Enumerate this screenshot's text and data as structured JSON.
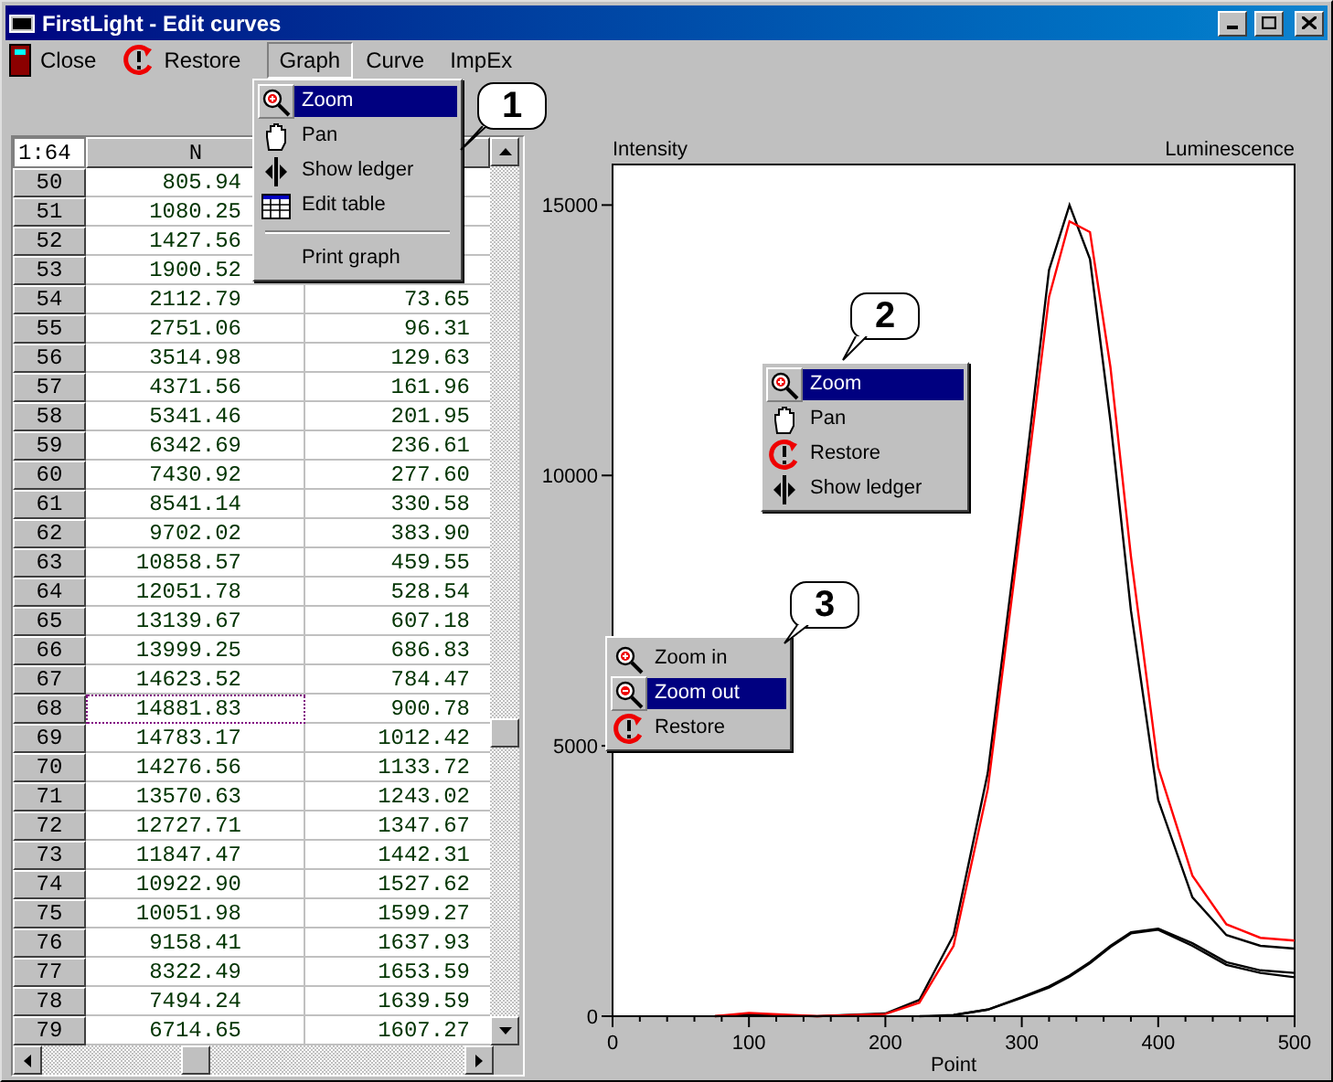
{
  "window": {
    "title": "FirstLight - Edit curves"
  },
  "toolbar": [
    {
      "label": "Close",
      "kind": "close"
    },
    {
      "label": "Restore",
      "kind": "restore"
    },
    {
      "label": "Graph",
      "kind": "menu",
      "selected": true
    },
    {
      "label": "Curve",
      "kind": "menu",
      "selected": false
    },
    {
      "label": "ImpEx",
      "kind": "menu",
      "selected": false
    }
  ],
  "table": {
    "corner": "1:64",
    "columns": [
      "N"
    ],
    "rows": [
      {
        "index": "50",
        "n": "805.94",
        "selected": false
      },
      {
        "index": "51",
        "n": "1080.25",
        "selected": false
      },
      {
        "index": "52",
        "n": "1427.56",
        "selected": false
      },
      {
        "index": "53",
        "n": "1900.52",
        "selected": false
      },
      {
        "index": "54",
        "n": "2112.79",
        "value": "73.65",
        "selected": false
      },
      {
        "index": "55",
        "n": "2751.06",
        "value": "96.31",
        "selected": false
      },
      {
        "index": "56",
        "n": "3514.98",
        "value": "129.63",
        "selected": false
      },
      {
        "index": "57",
        "n": "4371.56",
        "value": "161.96",
        "selected": false
      },
      {
        "index": "58",
        "n": "5341.46",
        "value": "201.95",
        "selected": false
      },
      {
        "index": "59",
        "n": "6342.69",
        "value": "236.61",
        "selected": false
      },
      {
        "index": "60",
        "n": "7430.92",
        "value": "277.60",
        "selected": false
      },
      {
        "index": "61",
        "n": "8541.14",
        "value": "330.58",
        "selected": false
      },
      {
        "index": "62",
        "n": "9702.02",
        "value": "383.90",
        "selected": false
      },
      {
        "index": "63",
        "n": "10858.57",
        "value": "459.55",
        "selected": false
      },
      {
        "index": "64",
        "n": "12051.78",
        "value": "528.54",
        "selected": false
      },
      {
        "index": "65",
        "n": "13139.67",
        "value": "607.18",
        "selected": false
      },
      {
        "index": "66",
        "n": "13999.25",
        "value": "686.83",
        "selected": false
      },
      {
        "index": "67",
        "n": "14623.52",
        "value": "784.47",
        "selected": false
      },
      {
        "index": "68",
        "n": "14881.83",
        "value": "900.78",
        "selected": true
      },
      {
        "index": "69",
        "n": "14783.17",
        "value": "1012.42",
        "selected": false
      },
      {
        "index": "70",
        "n": "14276.56",
        "value": "1133.72",
        "selected": false
      },
      {
        "index": "71",
        "n": "13570.63",
        "value": "1243.02",
        "selected": false
      },
      {
        "index": "72",
        "n": "12727.71",
        "value": "1347.67",
        "selected": false
      },
      {
        "index": "73",
        "n": "11847.47",
        "value": "1442.31",
        "selected": false
      },
      {
        "index": "74",
        "n": "10922.90",
        "value": "1527.62",
        "selected": false
      },
      {
        "index": "75",
        "n": "10051.98",
        "value": "1599.27",
        "selected": false
      },
      {
        "index": "76",
        "n": "9158.41",
        "value": "1637.93",
        "selected": false
      },
      {
        "index": "77",
        "n": "8322.49",
        "value": "1653.59",
        "selected": false
      },
      {
        "index": "78",
        "n": "7494.24",
        "value": "1639.59",
        "selected": false
      },
      {
        "index": "79",
        "n": "6714.65",
        "value": "1607.27",
        "selected": false
      }
    ]
  },
  "chart": {
    "left_label": "Intensity",
    "right_label": "Luminescence",
    "chart_data": {
      "type": "line",
      "xlabel": "Point",
      "x": [
        75,
        100,
        150,
        200,
        225,
        250,
        275,
        300,
        320,
        335,
        350,
        365,
        380,
        400,
        425,
        450,
        475,
        500
      ],
      "series": [
        {
          "color": "#000000",
          "values": [
            0,
            30,
            0,
            50,
            300,
            1500,
            4500,
            9500,
            13800,
            15000,
            14000,
            11000,
            7500,
            4000,
            2200,
            1500,
            1300,
            1250
          ]
        },
        {
          "color": "#ff0000",
          "values": [
            0,
            60,
            0,
            40,
            250,
            1300,
            4200,
            9200,
            13300,
            14700,
            14500,
            12000,
            8500,
            4600,
            2600,
            1700,
            1450,
            1400
          ]
        },
        {
          "color": "#000000",
          "values": [
            null,
            null,
            null,
            null,
            0,
            20,
            120,
            350,
            550,
            750,
            1000,
            1300,
            1550,
            1620,
            1350,
            1000,
            850,
            800
          ]
        },
        {
          "color": "#000000",
          "values": [
            null,
            null,
            null,
            null,
            null,
            20,
            120,
            340,
            530,
            730,
            980,
            1280,
            1530,
            1600,
            1300,
            950,
            800,
            720
          ]
        }
      ],
      "xlim": [
        0,
        500
      ],
      "ylim": [
        0,
        15750
      ],
      "xticks": [
        0,
        100,
        200,
        300,
        400,
        500
      ],
      "yticks": [
        0,
        5000,
        10000,
        15000
      ]
    }
  },
  "menus": [
    {
      "callout": "2",
      "items": [
        {
          "label": "Zoom",
          "kind": "zoom",
          "selected": true
        },
        {
          "label": "Pan",
          "kind": "pan",
          "selected": false
        },
        {
          "label": "Restore",
          "kind": "restore",
          "selected": false
        },
        {
          "label": "Show ledger",
          "kind": "ledger",
          "selected": false
        }
      ]
    },
    {
      "callout": "3",
      "items": [
        {
          "label": "Zoom in",
          "kind": "zoom",
          "selected": false
        },
        {
          "label": "Zoom out",
          "kind": "zoomout",
          "selected": true
        },
        {
          "label": "Restore",
          "kind": "restore",
          "selected": false
        }
      ]
    },
    {
      "callout": "1",
      "items": [
        {
          "label": "Zoom",
          "kind": "zoom",
          "selected": true
        },
        {
          "label": "Pan",
          "kind": "pan",
          "selected": false
        },
        {
          "label": "Show ledger",
          "kind": "ledger",
          "selected": false
        },
        {
          "label": "Edit table",
          "kind": "table",
          "selected": false
        },
        {
          "label": "Print graph",
          "kind": "print",
          "selected": false
        }
      ]
    }
  ]
}
